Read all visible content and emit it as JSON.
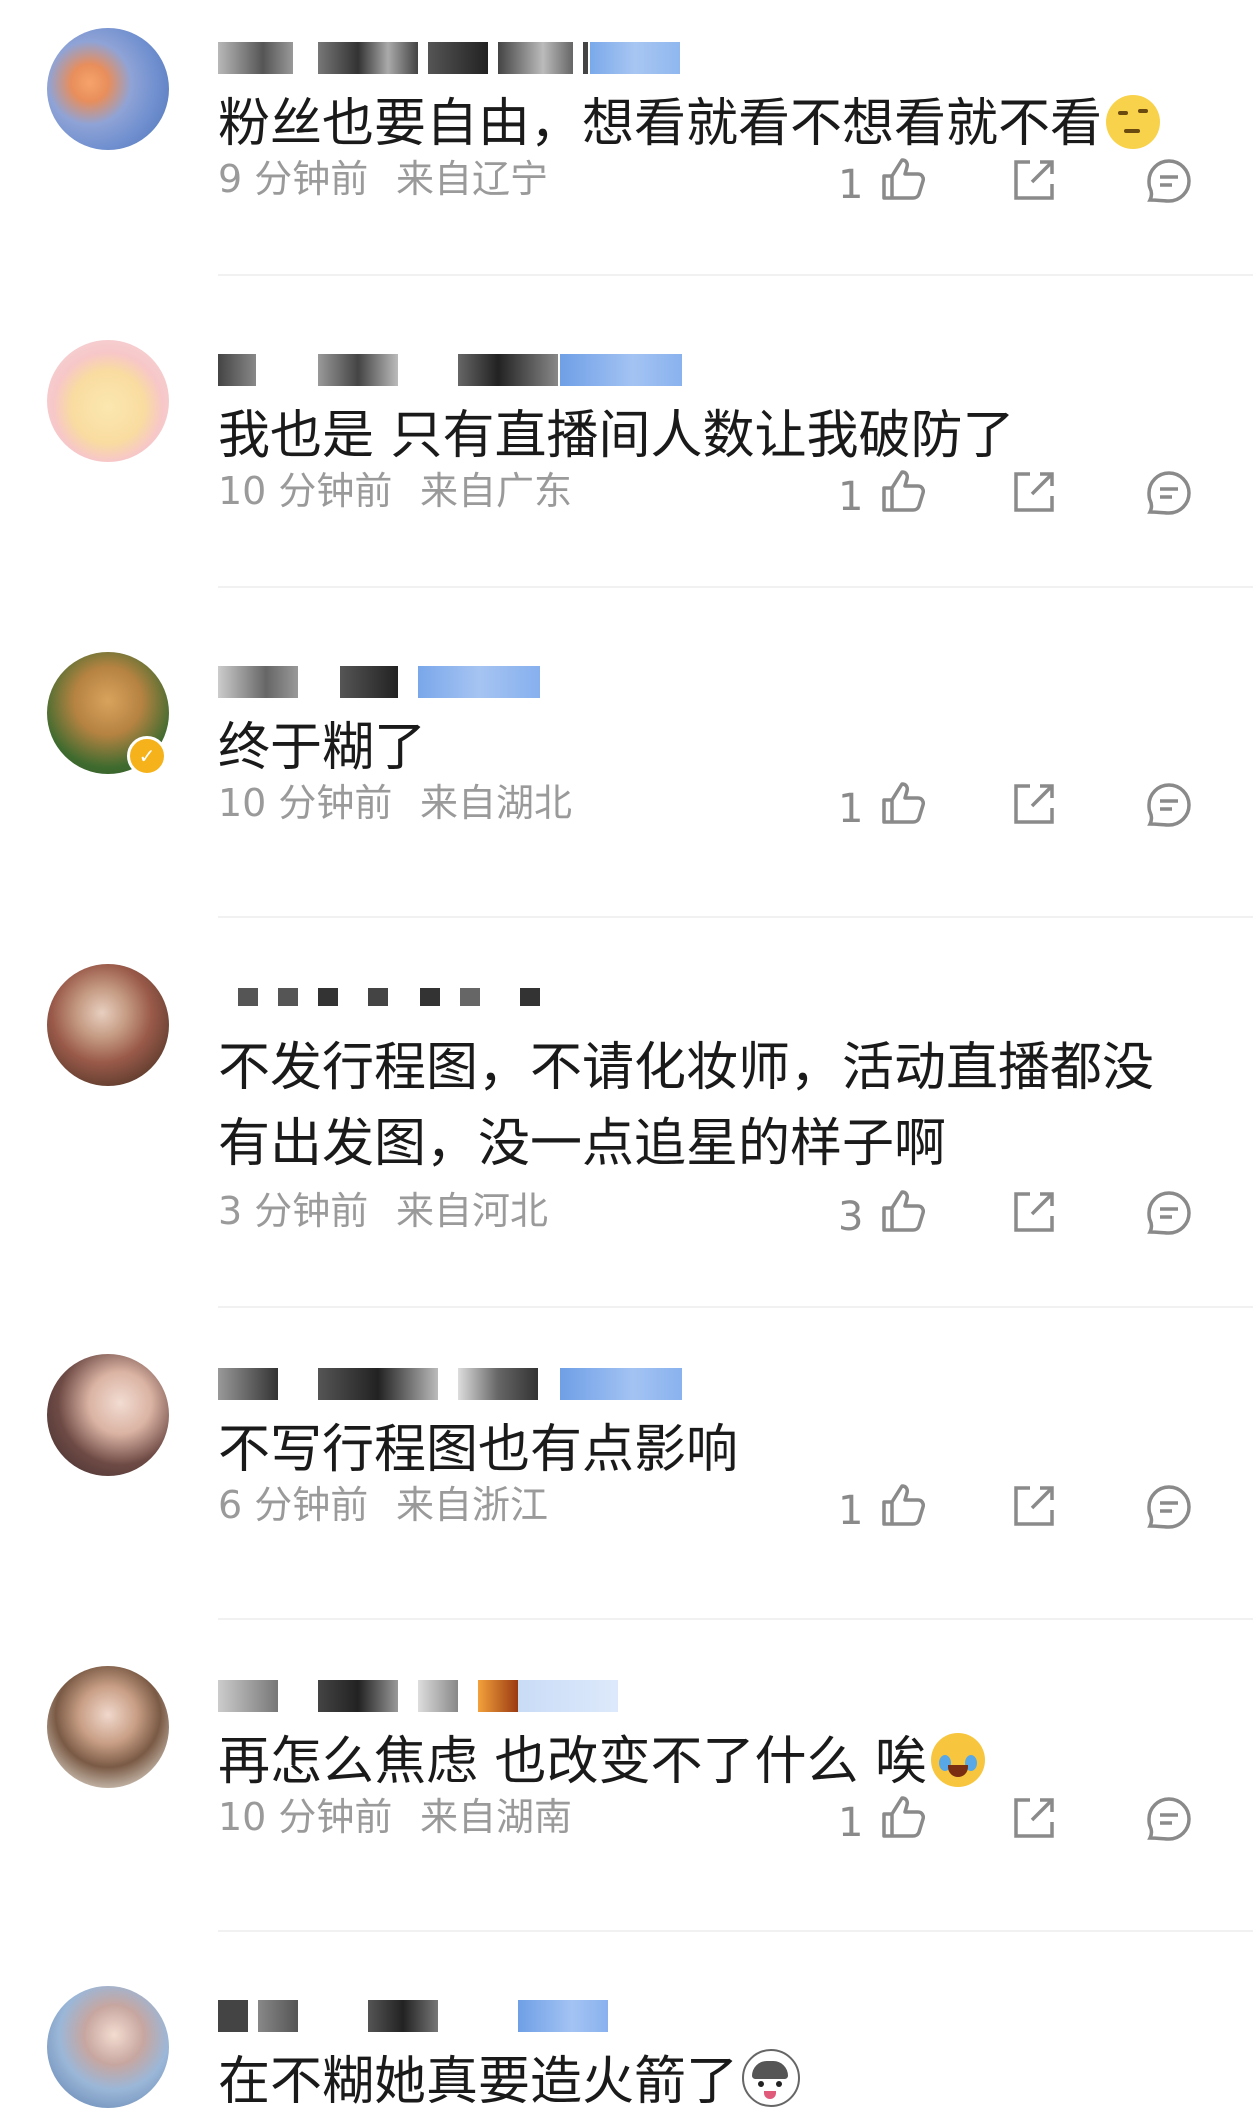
{
  "comments": [
    {
      "text": "粉丝也要自由，想看就看不想看就不看",
      "emoji": "thinking-face",
      "time": "9 分钟前",
      "location": "来自辽宁",
      "likes": "1"
    },
    {
      "text": "我也是 只有直播间人数让我破防了",
      "time": "10 分钟前",
      "location": "来自广东",
      "likes": "1"
    },
    {
      "text": "终于糊了",
      "time": "10 分钟前",
      "location": "来自湖北",
      "likes": "1"
    },
    {
      "text_line1": "不发行程图，不请化妆师，活动直播都没",
      "text_line2": "有出发图，没一点追星的样子啊",
      "time": "3 分钟前",
      "location": "来自河北",
      "likes": "3"
    },
    {
      "text": "不写行程图也有点影响",
      "time": "6 分钟前",
      "location": "来自浙江",
      "likes": "1"
    },
    {
      "text": "再怎么焦虑 也改变不了什么 唉",
      "emoji": "laughing-crying-face",
      "time": "10 分钟前",
      "location": "来自湖南",
      "likes": "1"
    },
    {
      "text": "在不糊她真要造火箭了",
      "emoji": "husky-face"
    }
  ],
  "icons": {
    "like": "thumbs-up-icon",
    "share": "share-icon",
    "reply": "comment-icon"
  },
  "colors": {
    "meta_text": "#9a9a9a",
    "verified_badge": "#f5b21b",
    "username_blur_blue": "#8fb8ef"
  }
}
